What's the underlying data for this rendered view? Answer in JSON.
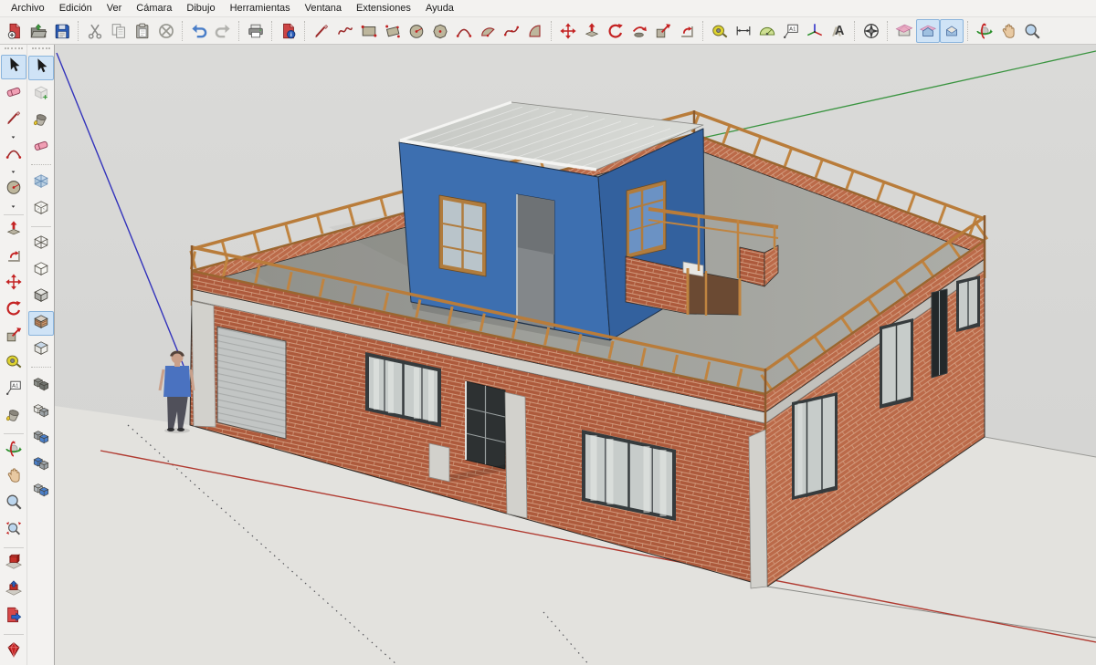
{
  "app": {
    "name": "SketchUp model window"
  },
  "menu_bar": {
    "items": [
      {
        "label": "Archivo"
      },
      {
        "label": "Edición"
      },
      {
        "label": "Ver"
      },
      {
        "label": "Cámara"
      },
      {
        "label": "Dibujo"
      },
      {
        "label": "Herramientas"
      },
      {
        "label": "Ventana"
      },
      {
        "label": "Extensiones"
      },
      {
        "label": "Ayuda"
      }
    ]
  },
  "top_toolbar": {
    "groups": [
      {
        "buttons": [
          {
            "name": "new-file",
            "icon": "file-new",
            "pressed": false
          },
          {
            "name": "open-file",
            "icon": "folder-open",
            "pressed": false
          },
          {
            "name": "save-file",
            "icon": "save",
            "pressed": false
          }
        ]
      },
      {
        "buttons": [
          {
            "name": "cut",
            "icon": "scissors",
            "pressed": false
          },
          {
            "name": "copy",
            "icon": "copy",
            "pressed": false
          },
          {
            "name": "paste",
            "icon": "paste",
            "pressed": false
          },
          {
            "name": "delete",
            "icon": "delete-x",
            "pressed": false
          }
        ]
      },
      {
        "buttons": [
          {
            "name": "undo",
            "icon": "undo",
            "pressed": false
          },
          {
            "name": "redo",
            "icon": "redo",
            "pressed": false
          }
        ]
      },
      {
        "buttons": [
          {
            "name": "print",
            "icon": "printer",
            "pressed": false
          }
        ]
      },
      {
        "buttons": [
          {
            "name": "model-info",
            "icon": "model-info",
            "pressed": false
          }
        ]
      },
      {
        "buttons": [
          {
            "name": "line-tool",
            "icon": "pencil",
            "pressed": false
          },
          {
            "name": "freehand-tool",
            "icon": "freehand",
            "pressed": false
          },
          {
            "name": "rectangle-tool",
            "icon": "rectangle",
            "pressed": false
          },
          {
            "name": "rotated-rectangle-tool",
            "icon": "rotated-rectangle",
            "pressed": false
          },
          {
            "name": "circle-tool",
            "icon": "circle-tool",
            "pressed": false
          },
          {
            "name": "polygon-tool",
            "icon": "polygon",
            "pressed": false
          },
          {
            "name": "arc-tool",
            "icon": "arc2",
            "pressed": false
          },
          {
            "name": "two-point-arc-tool",
            "icon": "pie",
            "pressed": false
          },
          {
            "name": "three-point-arc-tool",
            "icon": "arc3",
            "pressed": false
          },
          {
            "name": "pie-tool",
            "icon": "pie2",
            "pressed": false
          }
        ]
      },
      {
        "buttons": [
          {
            "name": "move-tool",
            "icon": "move",
            "pressed": false
          },
          {
            "name": "push-pull-tool",
            "icon": "push-pull",
            "pressed": false
          },
          {
            "name": "rotate-tool",
            "icon": "rotate",
            "pressed": false
          },
          {
            "name": "follow-me-tool",
            "icon": "follow-me",
            "pressed": false
          },
          {
            "name": "scale-tool",
            "icon": "scale",
            "pressed": false
          },
          {
            "name": "offset-tool",
            "icon": "offset",
            "pressed": false
          }
        ]
      },
      {
        "buttons": [
          {
            "name": "tape-measure-tool",
            "icon": "tape",
            "pressed": false
          },
          {
            "name": "dimension-tool",
            "icon": "dimension",
            "pressed": false
          },
          {
            "name": "protractor-tool",
            "icon": "protractor",
            "pressed": false
          },
          {
            "name": "text-tool",
            "icon": "text-a1",
            "pressed": false
          },
          {
            "name": "axes-tool",
            "icon": "axes",
            "pressed": false
          },
          {
            "name": "3d-text-tool",
            "icon": "text3d",
            "pressed": false
          }
        ]
      },
      {
        "buttons": [
          {
            "name": "position-camera",
            "icon": "compass",
            "pressed": false
          }
        ]
      },
      {
        "buttons": [
          {
            "name": "section-plane",
            "icon": "section-house",
            "pressed": false
          },
          {
            "name": "display-section-planes",
            "icon": "section-display",
            "pressed": true
          },
          {
            "name": "display-section-cuts",
            "icon": "section-cuts",
            "pressed": true
          }
        ]
      },
      {
        "buttons": [
          {
            "name": "orbit-tool",
            "icon": "orbit",
            "pressed": false
          },
          {
            "name": "pan-tool",
            "icon": "pan",
            "pressed": false
          },
          {
            "name": "zoom-tool",
            "icon": "zoom",
            "pressed": false
          }
        ]
      }
    ]
  },
  "left_toolbar_primary": {
    "items": [
      {
        "type": "grip"
      },
      {
        "type": "button",
        "name": "select",
        "icon": "select",
        "pressed": true
      },
      {
        "type": "button",
        "name": "eraser",
        "icon": "eraser",
        "pressed": false
      },
      {
        "type": "button",
        "name": "line",
        "icon": "pencil",
        "pressed": false
      },
      {
        "type": "caret",
        "name": "line-flyout"
      },
      {
        "type": "button",
        "name": "arc",
        "icon": "arc2",
        "pressed": false
      },
      {
        "type": "caret",
        "name": "arc-flyout"
      },
      {
        "type": "button",
        "name": "circle",
        "icon": "circle-tool",
        "pressed": false
      },
      {
        "type": "caret",
        "name": "circle-flyout"
      },
      {
        "type": "sep"
      },
      {
        "type": "button",
        "name": "push-pull",
        "icon": "push-pull",
        "pressed": false
      },
      {
        "type": "button",
        "name": "offset",
        "icon": "offset",
        "pressed": false
      },
      {
        "type": "button",
        "name": "move",
        "icon": "move",
        "pressed": false
      },
      {
        "type": "button",
        "name": "rotate",
        "icon": "rotate",
        "pressed": false
      },
      {
        "type": "button",
        "name": "scale",
        "icon": "scale",
        "pressed": false
      },
      {
        "type": "button",
        "name": "tape-measure",
        "icon": "tape",
        "pressed": false
      },
      {
        "type": "button",
        "name": "text",
        "icon": "text-a1",
        "pressed": false
      },
      {
        "type": "button",
        "name": "paint-bucket",
        "icon": "bucket",
        "pressed": false
      },
      {
        "type": "sep"
      },
      {
        "type": "button",
        "name": "orbit",
        "icon": "orbit",
        "pressed": false
      },
      {
        "type": "button",
        "name": "pan",
        "icon": "pan",
        "pressed": false
      },
      {
        "type": "button",
        "name": "zoom",
        "icon": "zoom",
        "pressed": false
      },
      {
        "type": "button",
        "name": "zoom-extents",
        "icon": "zoom-extents",
        "pressed": false
      },
      {
        "type": "sep"
      },
      {
        "type": "button",
        "name": "get-models",
        "icon": "get-models",
        "pressed": false
      },
      {
        "type": "button",
        "name": "share-model",
        "icon": "share-model",
        "pressed": false
      },
      {
        "type": "button",
        "name": "export-model",
        "icon": "export-page",
        "pressed": false
      },
      {
        "type": "sep"
      },
      {
        "type": "button",
        "name": "ruby-extension",
        "icon": "ruby",
        "pressed": false
      }
    ]
  },
  "left_toolbar_secondary": {
    "items": [
      {
        "type": "grip"
      },
      {
        "type": "button",
        "name": "select-2",
        "icon": "select",
        "pressed": true
      },
      {
        "type": "button",
        "name": "make-component",
        "icon": "make-component",
        "pressed": false
      },
      {
        "type": "button",
        "name": "paint-bucket-2",
        "icon": "bucket",
        "pressed": false
      },
      {
        "type": "button",
        "name": "eraser-2",
        "icon": "eraser",
        "pressed": false
      },
      {
        "type": "sep-dashed"
      },
      {
        "type": "button",
        "name": "style-xray",
        "icon": "box-xray",
        "pressed": false
      },
      {
        "type": "button",
        "name": "style-back-edges",
        "icon": "box-backedges",
        "pressed": false
      },
      {
        "type": "sep"
      },
      {
        "type": "button",
        "name": "style-wireframe",
        "icon": "box-wireframe",
        "pressed": false
      },
      {
        "type": "button",
        "name": "style-hidden-line",
        "icon": "box-hidden",
        "pressed": false
      },
      {
        "type": "button",
        "name": "style-shaded",
        "icon": "box-shaded",
        "pressed": false
      },
      {
        "type": "button",
        "name": "style-shaded-textures",
        "icon": "box-textured",
        "pressed": true
      },
      {
        "type": "button",
        "name": "style-monochrome",
        "icon": "box-monochrome",
        "pressed": false
      },
      {
        "type": "sep-dashed"
      },
      {
        "type": "button",
        "name": "solid-outer-shell",
        "icon": "solid-outer-shell",
        "pressed": false
      },
      {
        "type": "button",
        "name": "solid-intersect",
        "icon": "solid-intersect",
        "pressed": false
      },
      {
        "type": "button",
        "name": "solid-union",
        "icon": "solid-union",
        "pressed": false
      },
      {
        "type": "button",
        "name": "solid-subtract",
        "icon": "solid-subtract",
        "pressed": false
      },
      {
        "type": "button",
        "name": "solid-trim",
        "icon": "solid-trim",
        "pressed": false
      }
    ]
  },
  "viewport": {
    "scene_description": "3D model: single-storey brick building with concrete bands, garage door, windows, roof terrace with brick parapet and wooden railing, blue rooftop room with corrugated roof and wooden windows, brick rooftop enclosure, human scale figure, red/green/blue drawing axes",
    "objects": [
      "brick-building",
      "roof-terrace",
      "wood-railing",
      "rooftop-room",
      "rooftop-enclosure",
      "garage-door",
      "entry-door",
      "windows",
      "scale-figure",
      "drawing-axes"
    ],
    "colors": {
      "sky": "#d6d6d4",
      "ground": "#e3e2de",
      "brick_front": "#ad5a3c",
      "brick_side": "#bb6a49",
      "mortar": "#d8a98c",
      "concrete": "#d2d1cc",
      "concrete_dark": "#c2c1bc",
      "deck": "#9b9c97",
      "wood": "#c08440",
      "wood_dark": "#8a5a2e",
      "blue_front": "#3d6fb0",
      "blue_side": "#33619e",
      "blue_roof": "#cdcfcb",
      "glass": "#c7ccca",
      "glass_blue": "#6b92c4",
      "frame_dark": "#363b3d",
      "garage_gray": "#c2c5c4",
      "axis_red": "#b03a30",
      "axis_green": "#3a9440",
      "axis_blue": "#3333bb",
      "person_shirt": "#4a72c0",
      "person_pants": "#50505a",
      "skin": "#c9a08a",
      "edge": "#2f2d2a",
      "dark_opening": "#6b4a33"
    }
  },
  "ui": {
    "toolbar_bg": "#f1f0ee",
    "pressed_bg": "#cfe3f6",
    "pressed_border": "#8ab4dc"
  }
}
